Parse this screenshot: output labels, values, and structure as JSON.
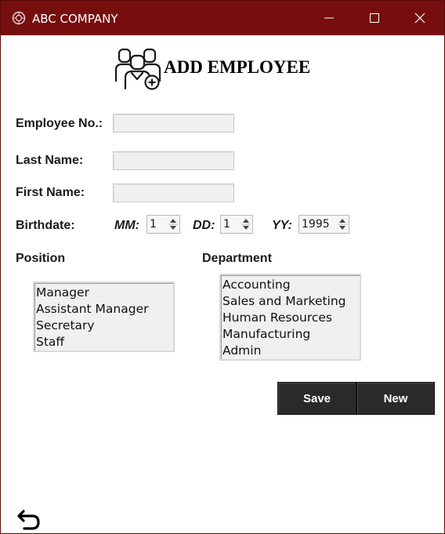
{
  "window": {
    "title": "ABC COMPANY",
    "title_bar_color": "#770e0e",
    "controls": [
      "minimize-icon",
      "maximize-icon",
      "close-icon"
    ]
  },
  "header": {
    "title": "ADD EMPLOYEE",
    "icon": "employees-group-icon"
  },
  "form": {
    "employee_no_label": "Employee No.:",
    "employee_no_value": "",
    "last_name_label": "Last Name:",
    "last_name_value": "",
    "first_name_label": "First Name:",
    "first_name_value": "",
    "birthdate_label": "Birthdate:",
    "mm_label": "MM:",
    "mm_value": "1",
    "dd_label": "DD:",
    "dd_value": "1",
    "yy_label": "YY:",
    "yy_value": "1995"
  },
  "position": {
    "label": "Position",
    "items": [
      "Manager",
      "Assistant Manager",
      "Secretary",
      "Staff"
    ]
  },
  "department": {
    "label": "Department",
    "items": [
      "Accounting",
      "Sales and Marketing",
      "Human Resources",
      "Manufacturing",
      "Admin"
    ]
  },
  "buttons": {
    "save_label": "Save",
    "new_label": "New",
    "color": "#2a2a2a"
  },
  "footer": {
    "back_icon": "back-arrow-icon"
  }
}
